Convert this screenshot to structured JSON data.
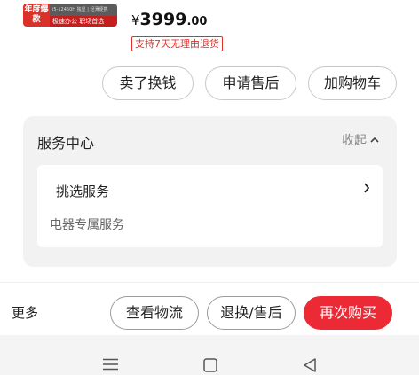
{
  "product": {
    "thumb_badge": "年度爆款",
    "thumb_line1": "i5-12450H 独显 | 轻薄便携",
    "thumb_line2": "极速办公 职场首选",
    "price_currency": "¥",
    "price_integer": "3999",
    "price_decimal": ".00",
    "return_tag": "支持7天无理由退货"
  },
  "actions": {
    "sell": "卖了换钱",
    "after_sales": "申请售后",
    "add_cart": "加购物车"
  },
  "service_center": {
    "title": "服务中心",
    "collapse_label": "收起",
    "pick_service": "挑选服务",
    "appliance_service": "电器专属服务"
  },
  "bottom_bar": {
    "more": "更多",
    "logistics": "查看物流",
    "return_exchange": "退换/售后",
    "buy_again": "再次购买"
  },
  "colors": {
    "accent": "#eb2a36",
    "tag_red": "#e0302a"
  },
  "icons": {
    "menu": "menu-icon",
    "home": "home-icon",
    "back": "back-icon"
  }
}
